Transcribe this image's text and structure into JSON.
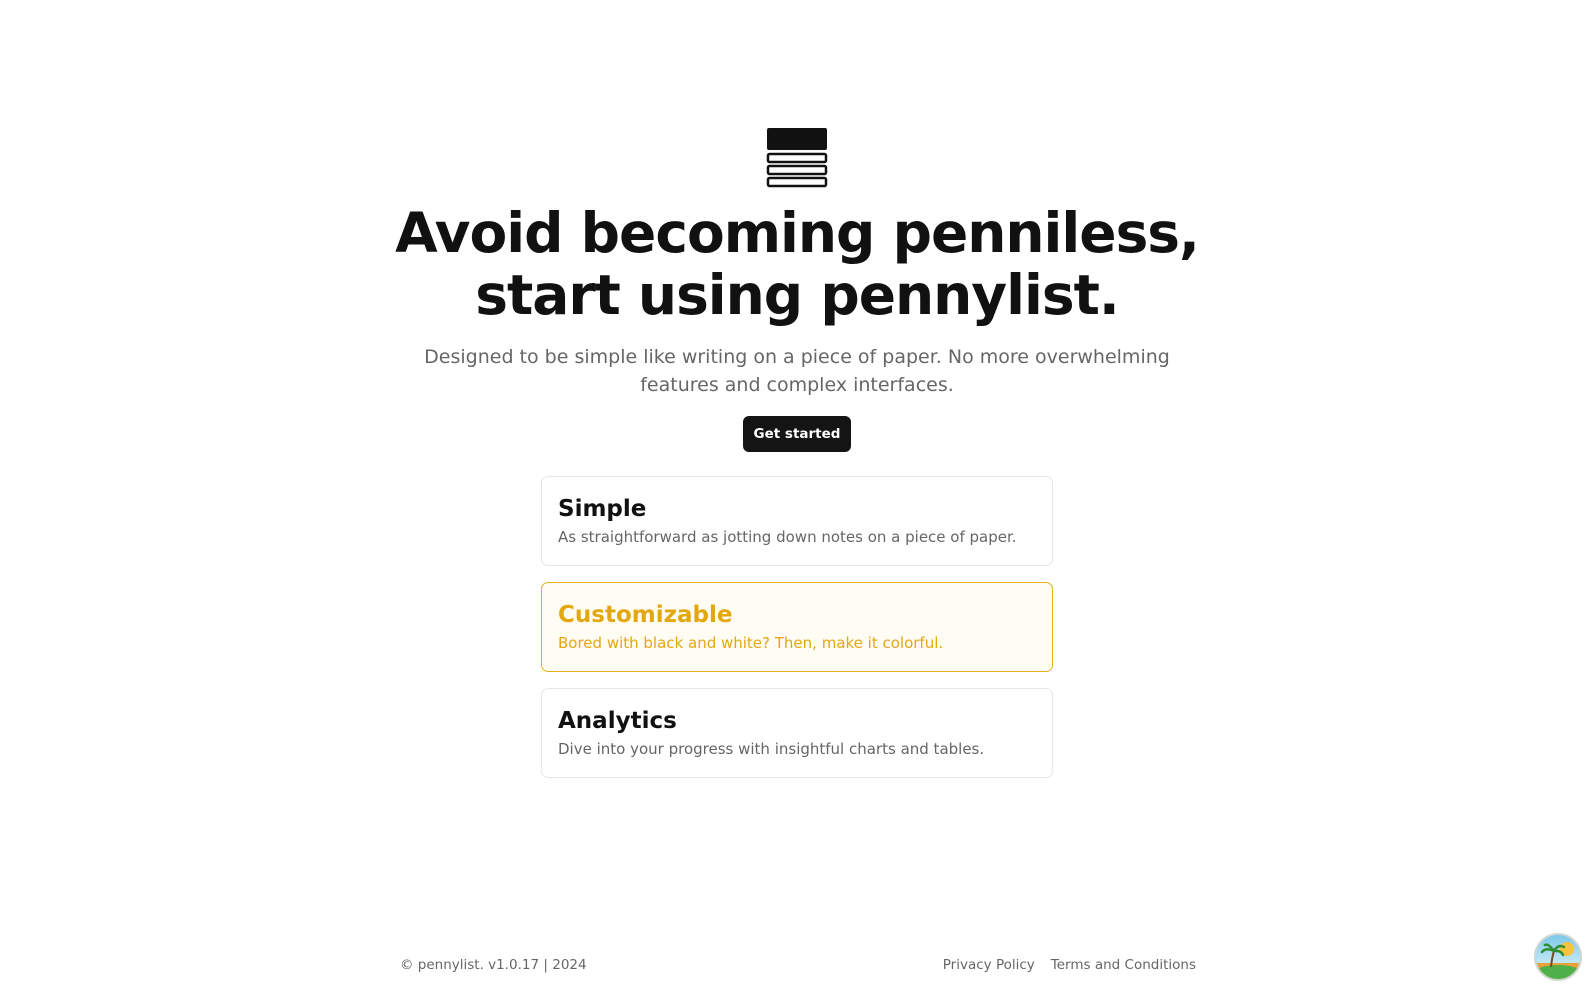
{
  "hero": {
    "title_line1": "Avoid becoming penniless,",
    "title_line2": "start using pennylist.",
    "subtitle": "Designed to be simple like writing on a piece of paper. No more overwhelming features and complex interfaces.",
    "cta_label": "Get started"
  },
  "logo": {
    "icon": "stacked-list-icon",
    "color": "#111111"
  },
  "features": [
    {
      "title": "Simple",
      "description": "As straightforward as jotting down notes on a piece of paper."
    },
    {
      "title": "Customizable",
      "description": "Bored with black and white? Then, make it colorful."
    },
    {
      "title": "Analytics",
      "description": "Dive into your progress with insightful charts and tables."
    }
  ],
  "footer": {
    "copyright": "© pennylist. v1.0.17 | 2024",
    "links": [
      "Privacy Policy",
      "Terms and Conditions"
    ]
  },
  "theme_toggle": {
    "icon": "palm-island-icon"
  },
  "colors": {
    "accent": "#e3a70f",
    "accent_border": "#e3b11c",
    "button_bg": "#141414",
    "muted_text": "#666666"
  }
}
